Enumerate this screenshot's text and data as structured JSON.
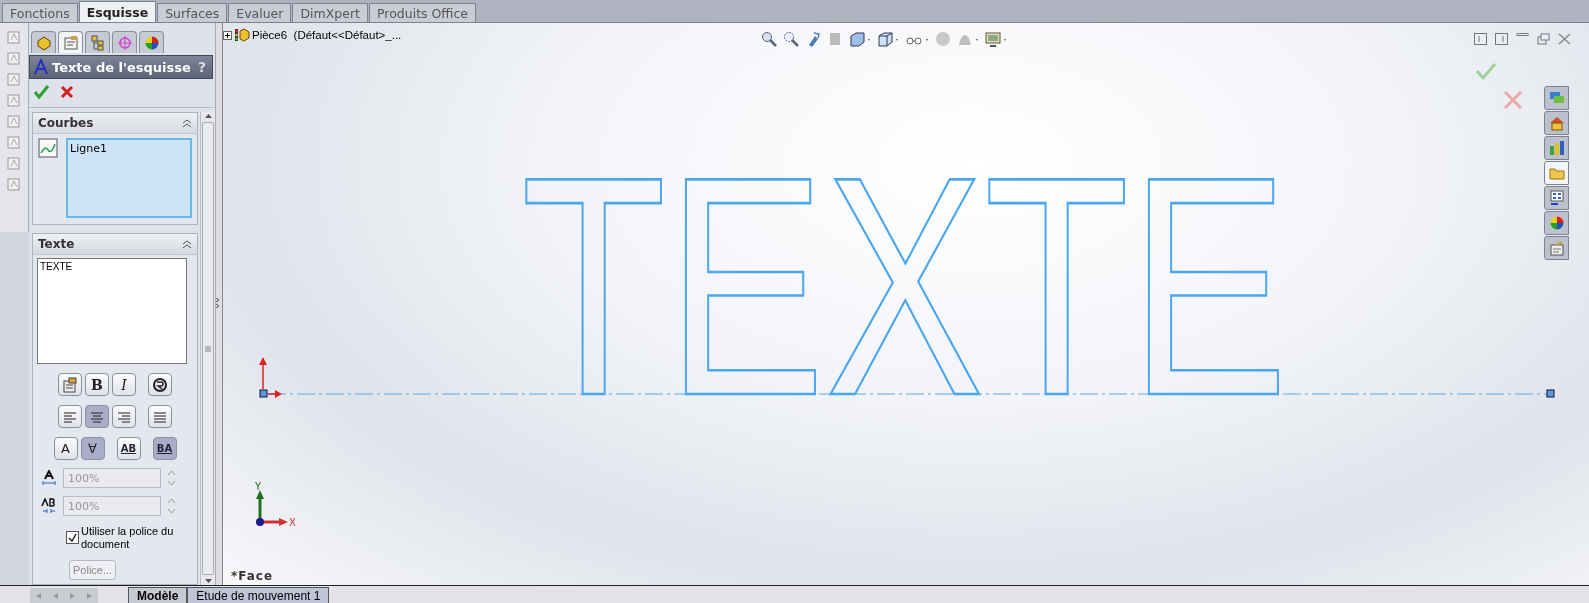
{
  "top_tabs": [
    {
      "label": "Fonctions",
      "selected": false
    },
    {
      "label": "Esquisse",
      "selected": true
    },
    {
      "label": "Surfaces",
      "selected": false
    },
    {
      "label": "Evaluer",
      "selected": false
    },
    {
      "label": "DimXpert",
      "selected": false
    },
    {
      "label": "Produits Office",
      "selected": false
    }
  ],
  "panel": {
    "tabs": [
      {
        "kind": "feature",
        "selected": false
      },
      {
        "kind": "property",
        "selected": true
      },
      {
        "kind": "config",
        "selected": false
      },
      {
        "kind": "dim",
        "selected": false
      },
      {
        "kind": "display",
        "selected": false
      }
    ],
    "title": "Texte de l'esquisse",
    "help": "?",
    "curves": {
      "title": "Courbes",
      "items": [
        "Ligne1"
      ]
    },
    "text": {
      "title": "Texte",
      "value": "TEXTE",
      "button_rows": [
        [
          {
            "kind": "insert",
            "selected": false
          },
          {
            "kind": "bold",
            "label": "B",
            "selected": false
          },
          {
            "kind": "italic",
            "label": "I",
            "selected": false
          },
          {
            "kind": "rotate",
            "selected": false
          }
        ],
        [
          {
            "kind": "align-left",
            "selected": false
          },
          {
            "kind": "align-center",
            "selected": true
          },
          {
            "kind": "align-right",
            "selected": false
          },
          {
            "kind": "justify",
            "selected": false
          }
        ],
        [
          {
            "kind": "flip-up",
            "label": "A",
            "selected": false
          },
          {
            "kind": "flip-down",
            "label": "∀",
            "selected": true
          },
          {
            "kind": "ltr",
            "label": "AB",
            "selected": false
          },
          {
            "kind": "rtl",
            "label": "BA",
            "selected": true
          }
        ]
      ],
      "spinners": [
        {
          "kind": "width",
          "value": "100%",
          "disabled": true
        },
        {
          "kind": "spacing",
          "value": "100%",
          "disabled": true
        }
      ],
      "checkbox": {
        "label": "Utiliser la police du document",
        "checked": true
      },
      "font_button": {
        "label": "Police...",
        "disabled": true
      }
    }
  },
  "viewport": {
    "tree_label": "Pièce6  (Défaut<<Défaut>_...",
    "sketch_text": "TEXTE",
    "view_label": "*Face",
    "axis_x": "X",
    "axis_y": "Y"
  },
  "task_tabs": [
    {
      "kind": "resources",
      "selected": false
    },
    {
      "kind": "home",
      "selected": false
    },
    {
      "kind": "library",
      "selected": false
    },
    {
      "kind": "folder",
      "selected": true
    },
    {
      "kind": "palette",
      "selected": false
    },
    {
      "kind": "appearance",
      "selected": false
    },
    {
      "kind": "properties",
      "selected": false
    }
  ],
  "bottom_tabs": [
    {
      "label": "Modèle",
      "selected": true
    },
    {
      "label": "Etude de mouvement 1",
      "selected": false
    }
  ]
}
